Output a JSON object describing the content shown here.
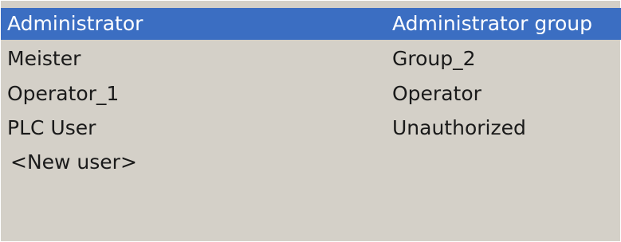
{
  "users": [
    {
      "name": "Administrator",
      "group": "Administrator group",
      "selected": true
    },
    {
      "name": "Meister",
      "group": "Group_2",
      "selected": false
    },
    {
      "name": "Operator_1",
      "group": "Operator",
      "selected": false
    },
    {
      "name": "PLC User",
      "group": "Unauthorized",
      "selected": false
    }
  ],
  "new_user_label": "<New user>",
  "colors": {
    "background": "#d4d0c8",
    "selection": "#3b6ec2",
    "selection_text": "#ffffff",
    "text": "#1a1a1a"
  }
}
